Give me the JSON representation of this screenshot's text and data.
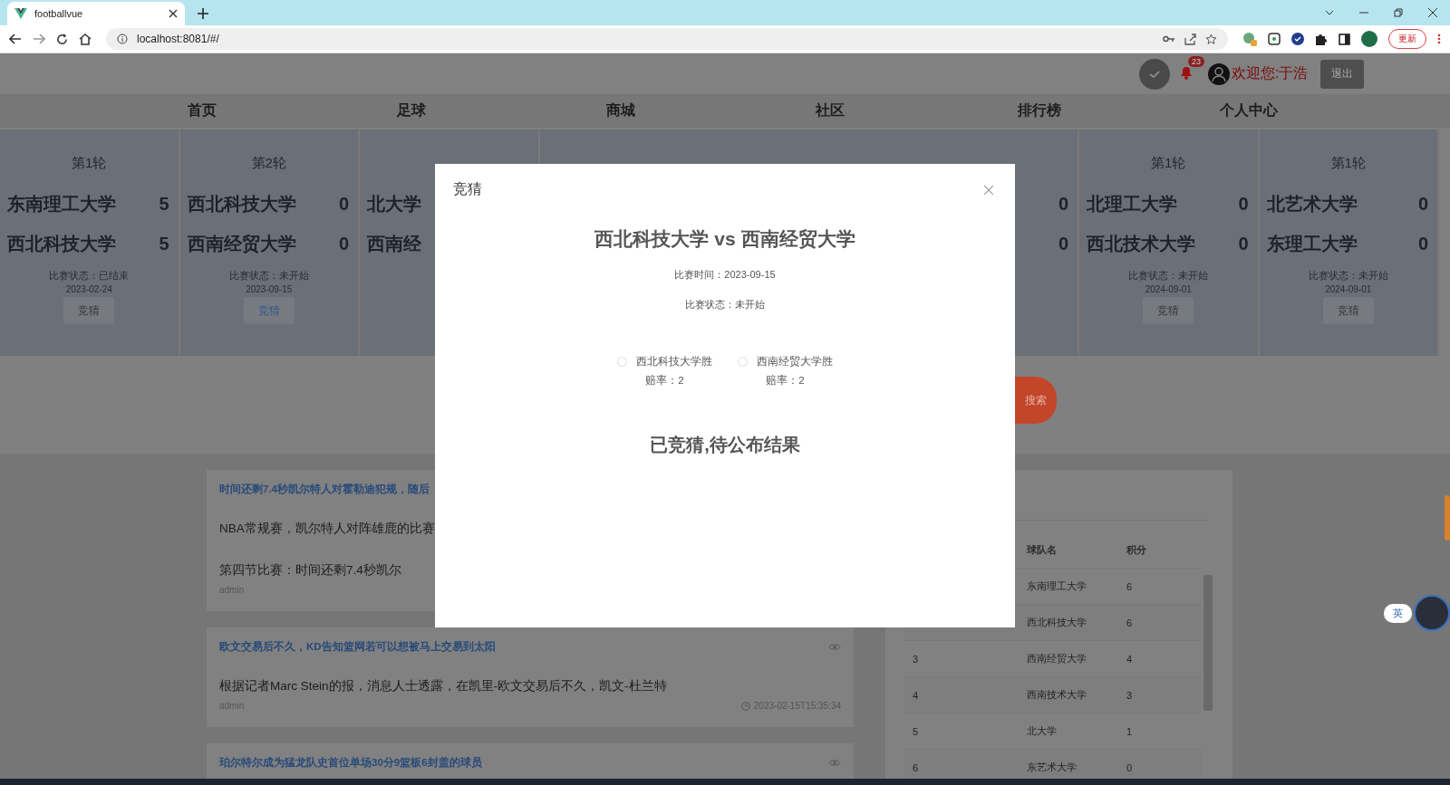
{
  "browser": {
    "tab_title": "footballvue",
    "url": "localhost:8081/#/",
    "update_button": "更新"
  },
  "header": {
    "notification_count": "23",
    "welcome": "欢迎您:于浩",
    "logout": "退出"
  },
  "nav": [
    {
      "label": "首页"
    },
    {
      "label": "足球"
    },
    {
      "label": "商城"
    },
    {
      "label": "社区"
    },
    {
      "label": "排行榜"
    },
    {
      "label": "个人中心"
    }
  ],
  "matches": [
    {
      "round": "第1轮",
      "teams": [
        {
          "name": "东南理工大学",
          "score": "5"
        },
        {
          "name": "西北科技大学",
          "score": "5"
        }
      ],
      "status": "比赛状态：已结束",
      "date": "2023-02-24",
      "button": {
        "label": "竞猜",
        "selected": false
      }
    },
    {
      "round": "第2轮",
      "teams": [
        {
          "name": "西北科技大学",
          "score": "0"
        },
        {
          "name": "西南经贸大学",
          "score": "0"
        }
      ],
      "status": "比赛状态：未开始",
      "date": "2023-09-15",
      "button": {
        "label": "竞猜",
        "selected": true
      }
    },
    {
      "teams": [
        {
          "name": "北大学"
        },
        {
          "name": "西南经"
        }
      ]
    },
    {
      "teams": [
        {
          "score": "0"
        },
        {
          "score": "0"
        }
      ]
    },
    {
      "round": "第1轮",
      "teams": [
        {
          "name": "北理工大学",
          "score": "0"
        },
        {
          "name": "西北技术大学",
          "score": "0"
        }
      ],
      "status": "比赛状态：未开始",
      "date": "2024-09-01",
      "button": {
        "label": "竞猜",
        "selected": false
      }
    },
    {
      "round": "第1轮",
      "teams": [
        {
          "name": "北艺术大学",
          "score": "0"
        },
        {
          "name": "东理工大学",
          "score": "0"
        }
      ],
      "status": "比赛状态：未开始",
      "date": "2024-09-01",
      "button": {
        "label": "竞猜",
        "selected": false
      }
    }
  ],
  "search_button": "搜索",
  "news": [
    {
      "title": "时间还剩7.4秒凯尔特人对霍勒迪犯规，随后",
      "body": [
        "NBA常规赛，凯尔特人对阵雄鹿的比赛",
        "第四节比赛：时间还剩7.4秒凯尔"
      ],
      "author": "admin"
    },
    {
      "title": "欧文交易后不久，KD告知篮网若可以想被马上交易到太阳",
      "body": [
        "根据记者Marc Stein的报，消息人士透露，在凯里-欧文交易后不久，凯文-杜兰特"
      ],
      "author": "admin",
      "time": "2023-02-15T15:35:34",
      "show_views": true
    },
    {
      "title": "珀尔特尔成为猛龙队史首位单场30分9篮板6封盖的球员",
      "show_views": true
    }
  ],
  "ranking": {
    "columns": [
      "球队名",
      "积分"
    ],
    "rows": [
      {
        "team": "东南理工大学",
        "points": "6"
      },
      {
        "team": "西北科技大学",
        "points": "6"
      },
      {
        "rank": "3",
        "team": "西南经贸大学",
        "points": "4"
      },
      {
        "rank": "4",
        "team": "西南技术大学",
        "points": "3"
      },
      {
        "rank": "5",
        "team": "北大学",
        "points": "1"
      },
      {
        "rank": "6",
        "team": "东艺术大学",
        "points": "0"
      }
    ]
  },
  "modal": {
    "title": "竞猜",
    "heading": "西北科技大学 vs 西南经贸大学",
    "time": "比赛时间：2023-09-15",
    "status": "比赛状态：未开始",
    "options": [
      {
        "label": "西北科技大学胜",
        "odds": "赔率：2",
        "selected": false
      },
      {
        "label": "西南经贸大学胜",
        "odds": "赔率：2",
        "selected": false
      }
    ],
    "result": "已竞猜,待公布结果"
  },
  "widget": {
    "label": "英"
  }
}
